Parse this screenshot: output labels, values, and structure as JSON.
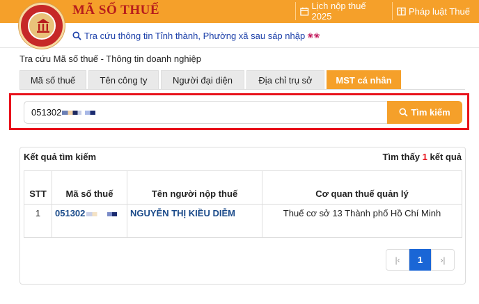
{
  "header": {
    "site_title": "MÃ SỐ THUẾ",
    "nav": [
      {
        "label": "Lịch nộp thuế 2025",
        "icon": "calendar-icon"
      },
      {
        "label": "Pháp luật Thuế",
        "icon": "book-icon"
      }
    ]
  },
  "subbar": {
    "link_label": "Tra cứu thông tin Tỉnh thành, Phường xã sau sáp nhập",
    "icon": "search-icon",
    "decoration": "❀❀"
  },
  "breadcrumb": "Tra cứu Mã số thuế - Thông tin doanh nghiệp",
  "tabs": [
    {
      "label": "Mã số thuế",
      "active": false
    },
    {
      "label": "Tên công ty",
      "active": false
    },
    {
      "label": "Người đại diện",
      "active": false
    },
    {
      "label": "Địa chỉ trụ sở",
      "active": false
    },
    {
      "label": "MST cá nhân",
      "active": true
    }
  ],
  "search": {
    "value": "051302",
    "button_label": "Tìm kiếm"
  },
  "results": {
    "title": "Kết quả tìm kiếm",
    "found_prefix": "Tìm thấy",
    "found_count": "1",
    "found_suffix": "kết quả",
    "columns": [
      "STT",
      "Mã số thuế",
      "Tên người nộp thuế",
      "Cơ quan thuế quản lý"
    ],
    "rows": [
      {
        "stt": "1",
        "mst": "051302",
        "name": "NGUYỄN THỊ KIỀU DIỄM",
        "agency": "Thuế cơ sở 13 Thành phố Hồ Chí Minh"
      }
    ]
  },
  "pagination": {
    "first": "|‹",
    "current": "1",
    "last": "›|"
  },
  "colors": {
    "brand_orange": "#f5a02a",
    "title_red": "#b71c1c",
    "highlight_red": "#e8121b",
    "link_blue": "#1a4a8a",
    "page_blue": "#1a66d6"
  }
}
